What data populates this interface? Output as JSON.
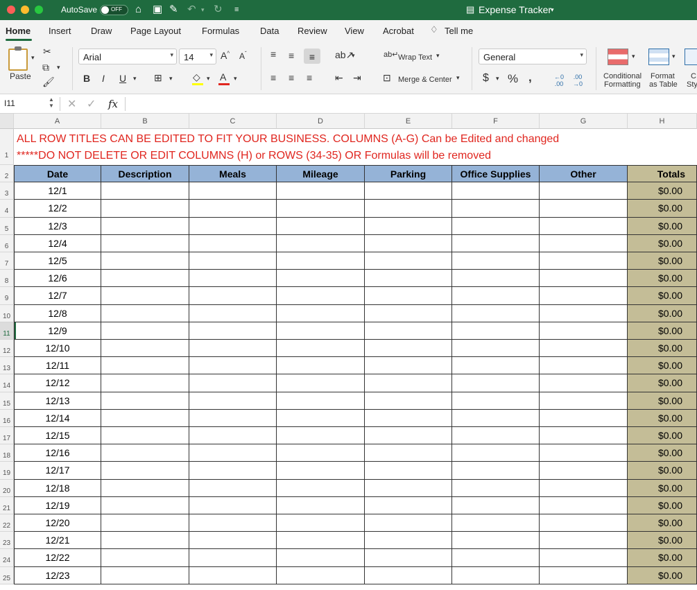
{
  "titlebar": {
    "autosave_label": "AutoSave",
    "autosave_state": "OFF",
    "doc_title": "Expense Tracker"
  },
  "tabs": [
    "Home",
    "Insert",
    "Draw",
    "Page Layout",
    "Formulas",
    "Data",
    "Review",
    "View",
    "Acrobat"
  ],
  "tell_me": "Tell me",
  "ribbon": {
    "paste": "Paste",
    "font_name": "Arial",
    "font_size": "14",
    "wrap_text": "Wrap Text",
    "merge_center": "Merge & Center",
    "number_format": "General",
    "conditional_formatting": [
      "Conditional",
      "Formatting"
    ],
    "format_as_table": [
      "Format",
      "as Table"
    ],
    "cell_styles_partial": [
      "C",
      "Sty"
    ]
  },
  "formula_bar": {
    "name_box": "I11",
    "fx": "fx",
    "value": ""
  },
  "columns": [
    "A",
    "B",
    "C",
    "D",
    "E",
    "F",
    "G",
    "H"
  ],
  "notes": {
    "line1": "ALL ROW TITLES CAN BE EDITED TO FIT YOUR BUSINESS. COLUMNS (A-G) Can be Edited and changed",
    "line2": "*****DO NOT DELETE OR EDIT COLUMNS (H) or ROWS (34-35) OR Formulas will be removed"
  },
  "headers": [
    "Date",
    "Description",
    "Meals",
    "Mileage",
    "Parking",
    "Office Supplies",
    "Other",
    "Totals"
  ],
  "rows": [
    {
      "num": "3",
      "date": "12/1",
      "total": "$0.00"
    },
    {
      "num": "4",
      "date": "12/2",
      "total": "$0.00"
    },
    {
      "num": "5",
      "date": "12/3",
      "total": "$0.00"
    },
    {
      "num": "6",
      "date": "12/4",
      "total": "$0.00"
    },
    {
      "num": "7",
      "date": "12/5",
      "total": "$0.00"
    },
    {
      "num": "8",
      "date": "12/6",
      "total": "$0.00"
    },
    {
      "num": "9",
      "date": "12/7",
      "total": "$0.00"
    },
    {
      "num": "10",
      "date": "12/8",
      "total": "$0.00"
    },
    {
      "num": "11",
      "date": "12/9",
      "total": "$0.00"
    },
    {
      "num": "12",
      "date": "12/10",
      "total": "$0.00"
    },
    {
      "num": "13",
      "date": "12/11",
      "total": "$0.00"
    },
    {
      "num": "14",
      "date": "12/12",
      "total": "$0.00"
    },
    {
      "num": "15",
      "date": "12/13",
      "total": "$0.00"
    },
    {
      "num": "16",
      "date": "12/14",
      "total": "$0.00"
    },
    {
      "num": "17",
      "date": "12/15",
      "total": "$0.00"
    },
    {
      "num": "18",
      "date": "12/16",
      "total": "$0.00"
    },
    {
      "num": "19",
      "date": "12/17",
      "total": "$0.00"
    },
    {
      "num": "20",
      "date": "12/18",
      "total": "$0.00"
    },
    {
      "num": "21",
      "date": "12/19",
      "total": "$0.00"
    },
    {
      "num": "22",
      "date": "12/20",
      "total": "$0.00"
    },
    {
      "num": "23",
      "date": "12/21",
      "total": "$0.00"
    },
    {
      "num": "24",
      "date": "12/22",
      "total": "$0.00"
    },
    {
      "num": "25",
      "date": "12/23",
      "total": "$0.00"
    }
  ],
  "selected_row": "11",
  "colors": {
    "title_bar": "#1f6b3f",
    "header_fill": "#95b3d7",
    "totals_fill": "#c4bd97",
    "note_text": "#e0261f"
  }
}
